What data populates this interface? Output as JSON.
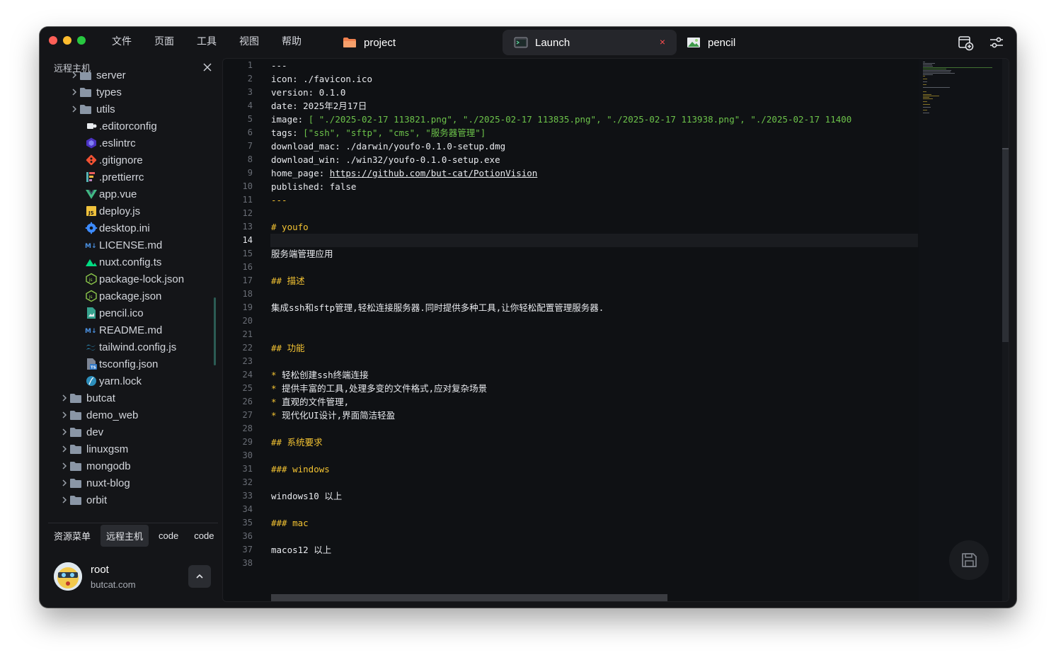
{
  "menu": [
    "文件",
    "页面",
    "工具",
    "视图",
    "帮助"
  ],
  "tabs": [
    {
      "label": "project",
      "icon": "folder-icon"
    },
    {
      "label": "Launch",
      "icon": "terminal-icon",
      "close": "×"
    },
    {
      "label": "pencil",
      "icon": "image-icon"
    }
  ],
  "sidebar": {
    "title": "远程主机",
    "tree": [
      {
        "label": "server",
        "type": "folder",
        "depth": 2,
        "icon": "folder-icon"
      },
      {
        "label": "types",
        "type": "folder",
        "depth": 2,
        "icon": "folder-icon"
      },
      {
        "label": "utils",
        "type": "folder",
        "depth": 2,
        "icon": "folder-icon"
      },
      {
        "label": ".editorconfig",
        "type": "file",
        "depth": 2,
        "icon": "editorconfig-icon"
      },
      {
        "label": ".eslintrc",
        "type": "file",
        "depth": 2,
        "icon": "eslint-icon"
      },
      {
        "label": ".gitignore",
        "type": "file",
        "depth": 2,
        "icon": "git-icon"
      },
      {
        "label": ".prettierrc",
        "type": "file",
        "depth": 2,
        "icon": "prettier-icon"
      },
      {
        "label": "app.vue",
        "type": "file",
        "depth": 2,
        "icon": "vue-icon"
      },
      {
        "label": "deploy.js",
        "type": "file",
        "depth": 2,
        "icon": "js-icon"
      },
      {
        "label": "desktop.ini",
        "type": "file",
        "depth": 2,
        "icon": "settings-icon"
      },
      {
        "label": "LICENSE.md",
        "type": "file",
        "depth": 2,
        "icon": "markdown-icon"
      },
      {
        "label": "nuxt.config.ts",
        "type": "file",
        "depth": 2,
        "icon": "nuxt-icon"
      },
      {
        "label": "package-lock.json",
        "type": "file",
        "depth": 2,
        "icon": "node-icon"
      },
      {
        "label": "package.json",
        "type": "file",
        "depth": 2,
        "icon": "node-icon"
      },
      {
        "label": "pencil.ico",
        "type": "file",
        "depth": 2,
        "icon": "image-file-icon"
      },
      {
        "label": "README.md",
        "type": "file",
        "depth": 2,
        "icon": "markdown-icon"
      },
      {
        "label": "tailwind.config.js",
        "type": "file",
        "depth": 2,
        "icon": "tailwind-icon"
      },
      {
        "label": "tsconfig.json",
        "type": "file",
        "depth": 2,
        "icon": "typescript-icon"
      },
      {
        "label": "yarn.lock",
        "type": "file",
        "depth": 2,
        "icon": "yarn-icon"
      },
      {
        "label": "butcat",
        "type": "folder",
        "depth": 1,
        "icon": "folder-icon"
      },
      {
        "label": "demo_web",
        "type": "folder",
        "depth": 1,
        "icon": "folder-icon"
      },
      {
        "label": "dev",
        "type": "folder",
        "depth": 1,
        "icon": "folder-icon"
      },
      {
        "label": "linuxgsm",
        "type": "folder",
        "depth": 1,
        "icon": "folder-icon"
      },
      {
        "label": "mongodb",
        "type": "folder",
        "depth": 1,
        "icon": "folder-icon"
      },
      {
        "label": "nuxt-blog",
        "type": "folder",
        "depth": 1,
        "icon": "folder-icon"
      },
      {
        "label": "orbit",
        "type": "folder",
        "depth": 1,
        "icon": "folder-icon"
      }
    ],
    "bottom_tabs": [
      {
        "label": "资源菜单",
        "active": false
      },
      {
        "label": "远程主机",
        "active": true
      },
      {
        "label": "code",
        "active": false
      },
      {
        "label": "code",
        "active": false
      }
    ],
    "user": {
      "name": "root",
      "domain": "butcat.com"
    }
  },
  "editor": {
    "current_line": 14,
    "line_count": 38,
    "lines": [
      [
        [
          "---",
          "w"
        ]
      ],
      [
        [
          "icon: ./favicon.ico",
          "w"
        ]
      ],
      [
        [
          "version: 0.1.0",
          "w"
        ]
      ],
      [
        [
          "date: 2025年2月17日",
          "w"
        ]
      ],
      [
        [
          "image: ",
          "w"
        ],
        [
          "[ \"./2025-02-17 113821.png\", \"./2025-02-17 113835.png\", \"./2025-02-17 113938.png\", \"./2025-02-17 11400",
          "g"
        ]
      ],
      [
        [
          "tags: ",
          "w"
        ],
        [
          "[\"ssh\", \"sftp\", \"cms\", \"服务器管理\"]",
          "g"
        ]
      ],
      [
        [
          "download_mac: ./darwin/youfo-0.1.0-setup.dmg",
          "w"
        ]
      ],
      [
        [
          "download_win: ./win32/youfo-0.1.0-setup.exe",
          "w"
        ]
      ],
      [
        [
          "home_page: ",
          "w"
        ],
        [
          "https://github.com/but-cat/PotionVision",
          "u"
        ]
      ],
      [
        [
          "published: false",
          "w"
        ]
      ],
      [
        [
          "---",
          "y"
        ]
      ],
      [],
      [
        [
          "# youfo",
          "y"
        ]
      ],
      [],
      [
        [
          "服务端管理应用",
          "w"
        ]
      ],
      [],
      [
        [
          "## 描述",
          "y"
        ]
      ],
      [],
      [
        [
          "集成ssh和sftp管理,轻松连接服务器.同时提供多种工具,让你轻松配置管理服务器.",
          "w"
        ]
      ],
      [],
      [],
      [
        [
          "## 功能",
          "y"
        ]
      ],
      [],
      [
        [
          "* ",
          "y"
        ],
        [
          "轻松创建ssh终端连接",
          "w"
        ]
      ],
      [
        [
          "* ",
          "y"
        ],
        [
          "提供丰富的工具,处理多变的文件格式,应对复杂场景",
          "w"
        ]
      ],
      [
        [
          "* ",
          "y"
        ],
        [
          "直观的文件管理,",
          "w"
        ]
      ],
      [
        [
          "* ",
          "y"
        ],
        [
          "现代化UI设计,界面简洁轻盈",
          "w"
        ]
      ],
      [],
      [
        [
          "## 系统要求",
          "y"
        ]
      ],
      [],
      [
        [
          "### windows",
          "y"
        ]
      ],
      [],
      [
        [
          "windows10 以上",
          "w"
        ]
      ],
      [],
      [
        [
          "### mac",
          "y"
        ]
      ],
      [],
      [
        [
          "macos12 以上",
          "w"
        ]
      ],
      []
    ]
  },
  "colors": {
    "accent_green": "#6cc24a",
    "heading_yellow": "#f2c232",
    "close_red": "#ff4d4f",
    "background": "#141518"
  }
}
